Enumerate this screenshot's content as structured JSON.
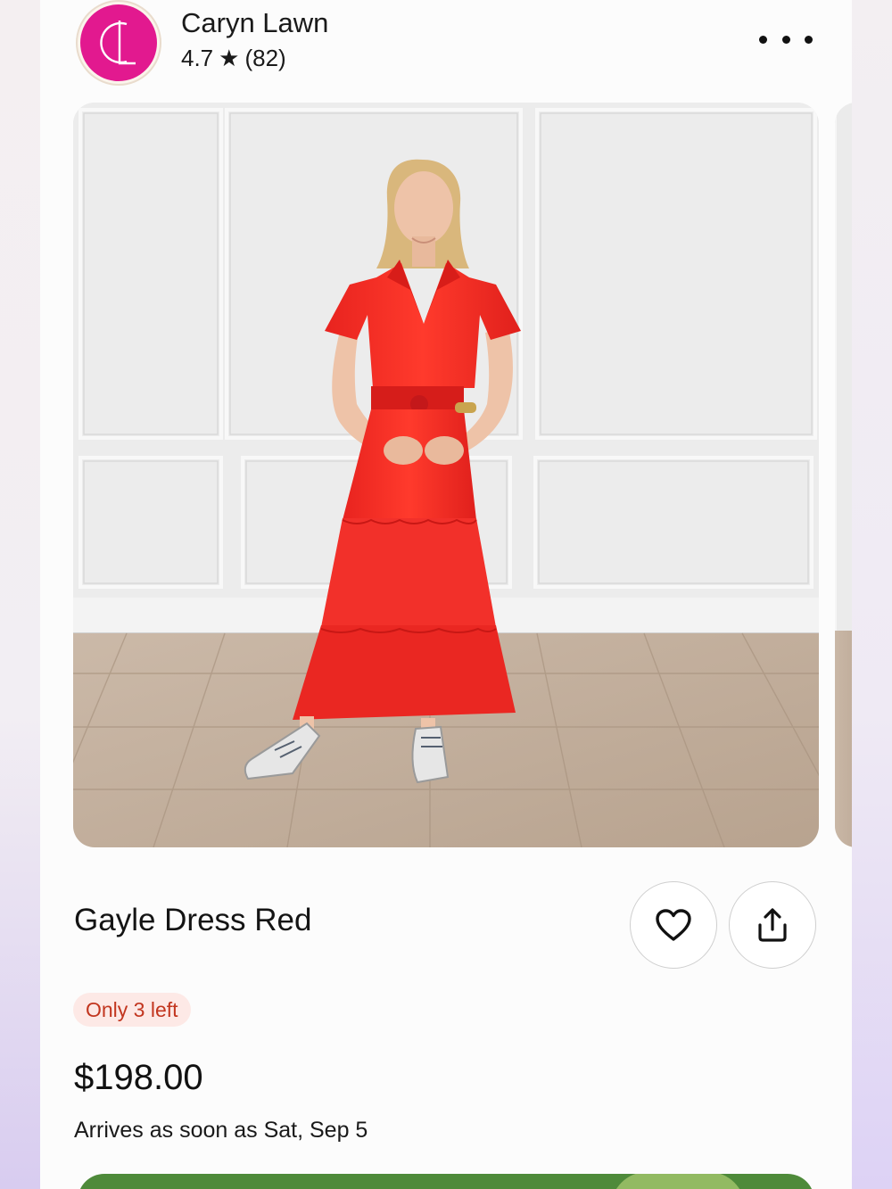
{
  "shop": {
    "name": "Caryn Lawn",
    "rating": "4.7",
    "rating_star": "★",
    "review_count": "(82)",
    "logo_colors": {
      "badge": "#e2198f",
      "ring": "#fbf4ec"
    },
    "logo_letters": "CL"
  },
  "header": {
    "more_icon": "more-horizontal-icon"
  },
  "product": {
    "image_alt": "Model wearing a red tiered midi dress with a collar, standing against a white paneled wall on a wood floor",
    "title": "Gayle Dress Red",
    "stock_badge": "Only 3 left",
    "price": "$198.00",
    "delivery": "Arrives as soon as Sat, Sep 5"
  },
  "actions": {
    "favorite_icon": "heart-outline-icon",
    "share_icon": "share-upload-icon"
  },
  "colors": {
    "accent_badge_bg": "#fde9e6",
    "accent_badge_text": "#c2361f",
    "cta_green": "#4e8a3a"
  }
}
